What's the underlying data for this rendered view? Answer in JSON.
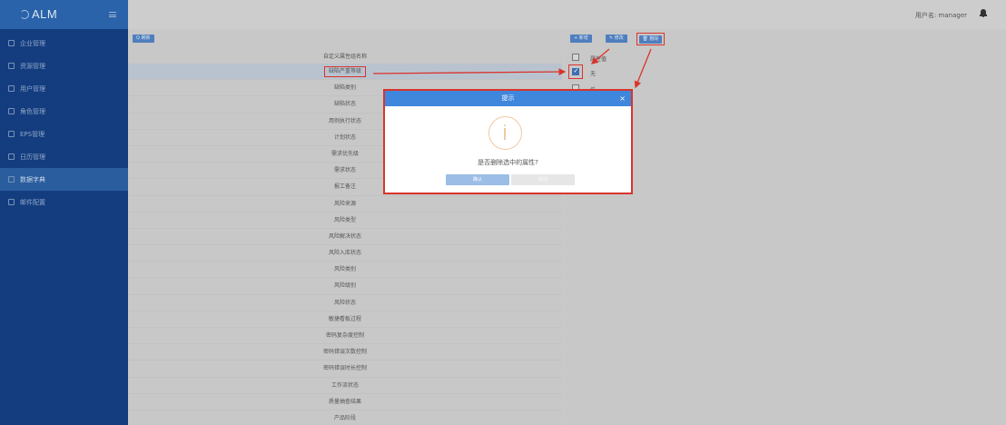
{
  "app": {
    "logo": "ALM"
  },
  "sidebar": {
    "items": [
      {
        "label": "企业管理",
        "icon": "building-icon"
      },
      {
        "label": "资源管理",
        "icon": "resource-icon"
      },
      {
        "label": "用户管理",
        "icon": "user-icon"
      },
      {
        "label": "角色管理",
        "icon": "role-icon"
      },
      {
        "label": "EPS管理",
        "icon": "folder-icon"
      },
      {
        "label": "日历管理",
        "icon": "calendar-icon"
      },
      {
        "label": "数据字典",
        "icon": "dictionary-icon",
        "active": true
      },
      {
        "label": "邮件配置",
        "icon": "mail-icon"
      }
    ]
  },
  "header": {
    "user": "用户名: manager",
    "icon": "bell-icon"
  },
  "left": {
    "search": "Q 刷新",
    "header": "自定义属性组名称",
    "rows": [
      "缺陷严重等级",
      "缺陷类别",
      "缺陷状态",
      "用例执行状态",
      "计划状态",
      "需求优先级",
      "需求状态",
      "报工备注",
      "风险来源",
      "风险类型",
      "风险解决状态",
      "风险入库状态",
      "风险类别",
      "风险级别",
      "风险状态",
      "敏捷看板过程",
      "密码复杂度控制",
      "密码错误次数控制",
      "密码错误时长控制",
      "工作流状态",
      "质量抽查结果",
      "产品阶段"
    ],
    "selected_index": 0
  },
  "right": {
    "add": "+ 新增",
    "edit": "✎ 修改",
    "delete": "🗑 删除",
    "header": "属性值",
    "rows": [
      {
        "label": "无",
        "checked": true
      },
      {
        "label": "低",
        "checked": false
      }
    ]
  },
  "dialog": {
    "title": "提示",
    "close": "×",
    "message": "是否删除选中的属性?",
    "confirm": "确认",
    "cancel": "取消"
  },
  "colors": {
    "annotation": "#d9342b",
    "sidebar": "#143d7f",
    "primary": "#3f86dd"
  }
}
